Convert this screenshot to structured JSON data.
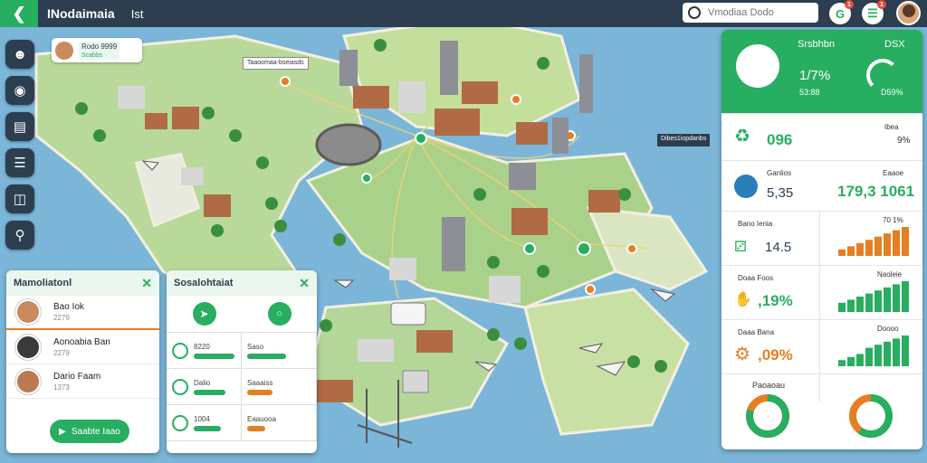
{
  "header": {
    "app_title": "INodaimaia",
    "tab": "Ist",
    "search_placeholder": "Vmodiaa Dodo",
    "notif_count": "1",
    "alert_count": "1"
  },
  "sidebar": {
    "items": [
      {
        "icon": "users-icon"
      },
      {
        "icon": "location-icon"
      },
      {
        "icon": "document-icon"
      },
      {
        "icon": "list-icon"
      },
      {
        "icon": "columns-icon"
      },
      {
        "icon": "search-icon"
      }
    ]
  },
  "map": {
    "profile_tag": {
      "name": "Rodo",
      "sub": "9999",
      "detail": "Scabbs"
    },
    "label_top": "Taaoomaa-bseiasds",
    "label_right": "Dibes1iopdanbs"
  },
  "left_panel": {
    "title": "Mamoliatonl",
    "members": [
      {
        "name": "Bao Iok",
        "sub": "2279"
      },
      {
        "name": "Aonoabia Ban",
        "sub": "2279"
      },
      {
        "name": "Dario Faam",
        "sub": "1373"
      }
    ],
    "button": "Saabte Iaao"
  },
  "mid_panel": {
    "title": "Sosalohtaiat",
    "cells": [
      {
        "label": "8220",
        "pct": 0.9
      },
      {
        "label": "Saso",
        "pct": 0.85
      },
      {
        "label": "Dalio",
        "pct": 0.7
      },
      {
        "label": "Saaaiss",
        "pct": 0.55
      },
      {
        "label": "1004",
        "pct": 0.6
      },
      {
        "label": "Eaauooa",
        "pct": 0.4
      }
    ]
  },
  "right_panel": {
    "header_title": "Srsbhbn",
    "header_code": "DSX",
    "header_value": "1/7%",
    "header_sub": "53:88",
    "header_right_sub": "D59%",
    "rows": [
      {
        "icon": "recycle-icon",
        "value": "096",
        "right_label": "Ibea",
        "right_value": "9%"
      },
      {
        "icon": "globe-icon",
        "label": "Ganlios",
        "value": "5,35",
        "right_label": "Eaaoe",
        "right_value": "179,3 1061"
      },
      {
        "icon": "trend-icon",
        "label": "Bano Ienia",
        "value": "14.5",
        "right_label": "70 1%"
      },
      {
        "icon": "hand-icon",
        "label": "Doaa Foos",
        "value": ",19%",
        "right_label": "Naoleie"
      },
      {
        "icon": "gear-icon",
        "label": "Daaa Bana",
        "value": ",09%",
        "right_label": "Doooo"
      }
    ],
    "donut_label": "Paoaoau",
    "bars_a": [
      2,
      3,
      4,
      5,
      6,
      7,
      8,
      9
    ],
    "bars_b": [
      3,
      4,
      5,
      6,
      7,
      8,
      9,
      10
    ],
    "bars_c": [
      2,
      3,
      4,
      6,
      7,
      8,
      9,
      10
    ],
    "bars_d": [
      2,
      3,
      4,
      5,
      6,
      7,
      8,
      9
    ],
    "donut1_pct": 0.8,
    "donut2_pct": 0.6
  },
  "colors": {
    "accent": "#27ae60",
    "orange": "#e67e22",
    "header": "#2c3e50"
  }
}
